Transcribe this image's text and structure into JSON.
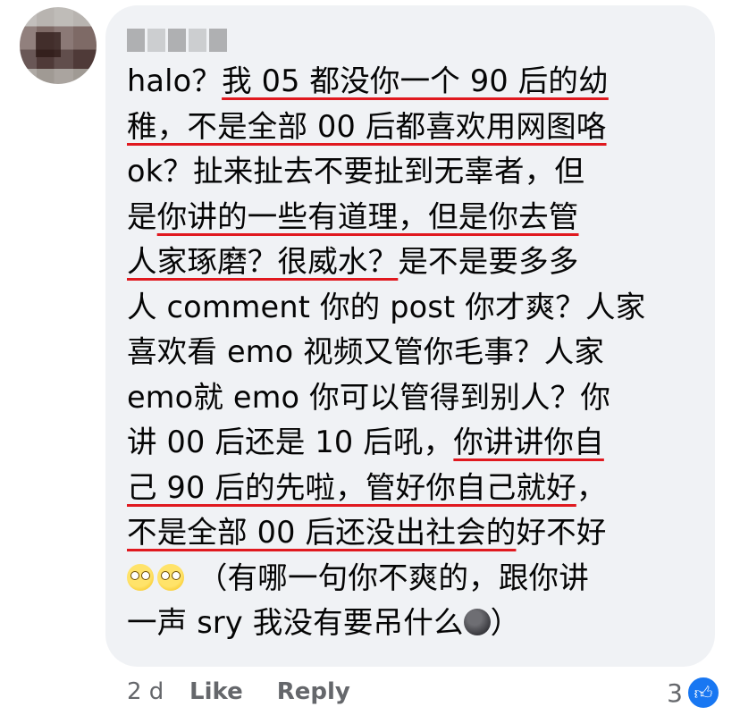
{
  "comment": {
    "lines": [
      [
        {
          "t": "halo？"
        },
        {
          "t": "我 05 都没你一个 90 后的幼",
          "u": true
        }
      ],
      [
        {
          "t": "稚，不是全部 00 后都喜欢用网图咯",
          "u": true
        }
      ],
      [
        {
          "t": "ok？扯来扯去不要扯到无辜者，但"
        }
      ],
      [
        {
          "t": "是"
        },
        {
          "t": "你讲的一些有道理，但是你去管",
          "u": true
        }
      ],
      [
        {
          "t": "人家琢磨？很威水？",
          "u": true
        },
        {
          "t": "是不是要多多"
        }
      ],
      [
        {
          "t": "人 comment 你的 post 你才爽？人家"
        }
      ],
      [
        {
          "t": "喜欢看 emo 视频又管你毛事？人家"
        }
      ],
      [
        {
          "t": "emo就 emo 你可以管得到别人？你"
        }
      ],
      [
        {
          "t": "讲 00 后还是 10 后吼，"
        },
        {
          "t": "你讲讲你自",
          "u": true
        }
      ],
      [
        {
          "t": "己 90 后的先啦，管好你自己就好",
          "u": true
        },
        {
          "t": "，"
        }
      ],
      [
        {
          "t": "不是全部 00 后还没出社会的",
          "u": true
        },
        {
          "t": "好不好"
        }
      ],
      [
        {
          "e": "face-with-rolling-eyes-emoji"
        },
        {
          "e": "face-with-rolling-eyes-emoji"
        },
        {
          "t": "  （有哪一句你不爽的，跟你讲"
        }
      ],
      [
        {
          "t": "一声 sry 我没有要吊什么"
        },
        {
          "e": "new-moon-face-emoji"
        },
        {
          "t": "）"
        }
      ]
    ]
  },
  "footer": {
    "age": "2 d",
    "like_label": "Like",
    "reply_label": "Reply",
    "reaction_count": "3",
    "reaction_icon": "thumbs-up-icon"
  },
  "colors": {
    "bubble": "#f0f2f5",
    "underline": "#e0191f",
    "meta_text": "#65676b",
    "like_blue": "#1877f2"
  }
}
